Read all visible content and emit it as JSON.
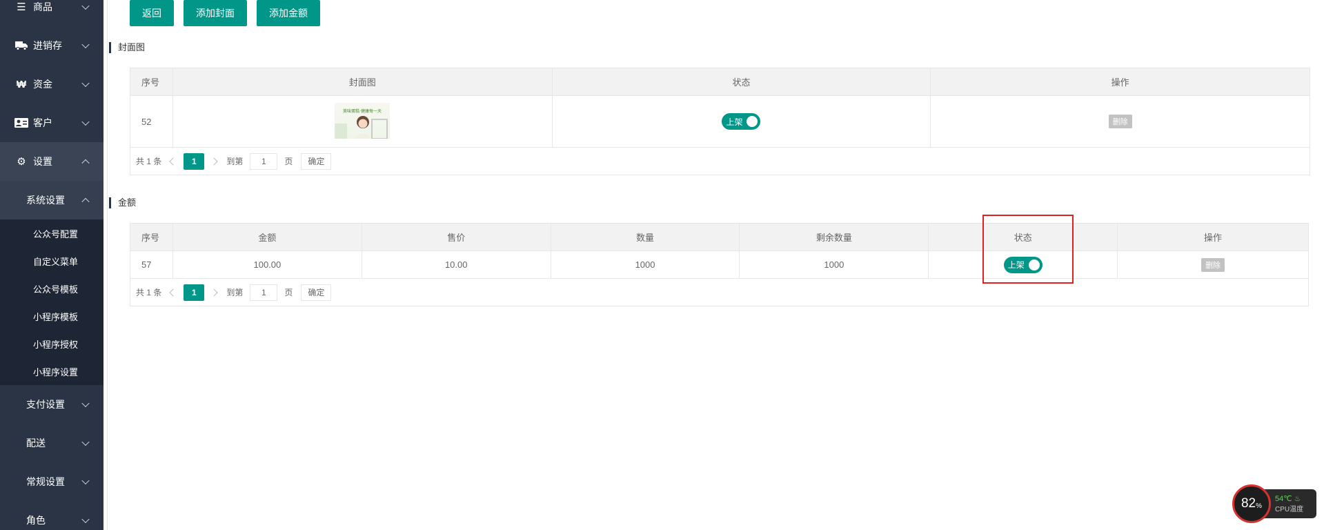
{
  "sidebar": {
    "items": [
      {
        "label": "商品",
        "icon": "menu-icon"
      },
      {
        "label": "进销存",
        "icon": "truck-icon"
      },
      {
        "label": "资金",
        "icon": "won-icon"
      },
      {
        "label": "客户",
        "icon": "id-card-icon"
      },
      {
        "label": "设置",
        "icon": "gear-icon"
      }
    ],
    "sub_active": "系统设置",
    "children": [
      "公众号配置",
      "自定义菜单",
      "公众号模板",
      "小程序模板",
      "小程序授权",
      "小程序设置"
    ],
    "more": [
      "支付设置",
      "配送",
      "常规设置",
      "角色"
    ]
  },
  "toolbar": {
    "back": "返回",
    "add_cover": "添加封面",
    "add_amount": "添加金额"
  },
  "cover_section": {
    "title": "封面图",
    "headers": [
      "序号",
      "封面图",
      "状态",
      "操作"
    ],
    "rows": [
      {
        "id": "52",
        "status": "上架",
        "action": "删除"
      }
    ],
    "cover_text": "美味蛋糕·健康每一天"
  },
  "amount_section": {
    "title": "金额",
    "headers": [
      "序号",
      "金额",
      "售价",
      "数量",
      "剩余数量",
      "状态",
      "操作"
    ],
    "rows": [
      {
        "id": "57",
        "amount": "100.00",
        "price": "10.00",
        "qty": "1000",
        "remaining": "1000",
        "status": "上架",
        "action": "删除"
      }
    ]
  },
  "pager": {
    "total": "共 1 条",
    "current": "1",
    "goto": "到第",
    "page_input": "1",
    "page_unit": "页",
    "confirm": "确定"
  },
  "cpu": {
    "usage": "82",
    "usage_unit": "%",
    "temp": "54℃",
    "label": "CPU温度"
  },
  "colors": {
    "sidebar": "#2b3444",
    "primary": "#009688",
    "highlight": "#e02020"
  }
}
